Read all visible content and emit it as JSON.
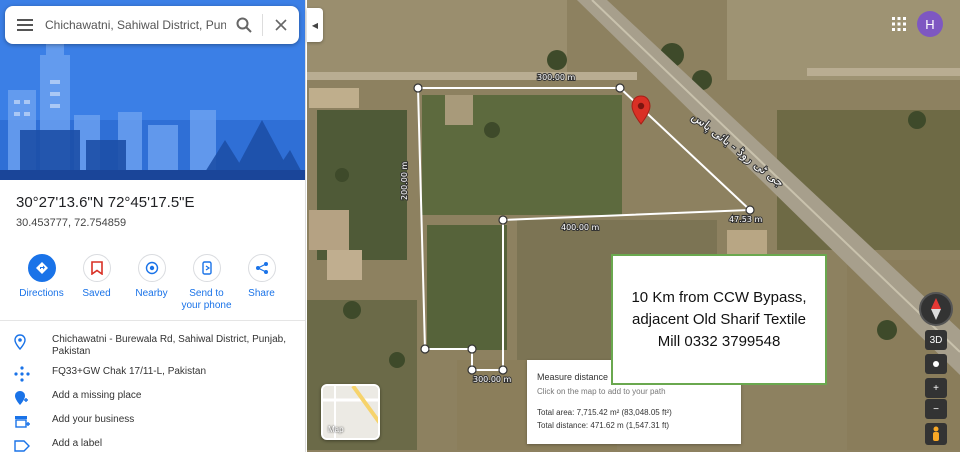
{
  "search": {
    "value": "Chichawatni, Sahiwal District, Punjab",
    "placeholder": "Search Google Maps"
  },
  "location": {
    "coords_dms": "30°27'13.6\"N 72°45'17.5\"E",
    "coords_decimal": "30.453777, 72.754859"
  },
  "actions": [
    {
      "label": "Directions",
      "icon": "directions-icon"
    },
    {
      "label": "Saved",
      "icon": "bookmark-icon"
    },
    {
      "label": "Nearby",
      "icon": "nearby-icon"
    },
    {
      "label": "Send to your phone",
      "icon": "send-to-phone-icon"
    },
    {
      "label": "Share",
      "icon": "share-icon"
    }
  ],
  "info": {
    "address": "Chichawatni - Burewala Rd, Sahiwal District, Punjab, Pakistan",
    "plus_code": "FQ33+GW Chak 17/11-L, Pakistan",
    "add_place": "Add a missing place",
    "add_business": "Add your business",
    "add_label": "Add a label"
  },
  "map": {
    "road_name": "جی ٹی روڈ - بائی پاس",
    "segments": [
      "300.00 m",
      "200.00 m",
      "400.00 m",
      "47.53 m",
      "300.00 m"
    ],
    "annotation_lines": [
      "10 Km from CCW Bypass,",
      "adjacent Old Sharif Textile",
      "Mill 0332 3799548"
    ],
    "measure": {
      "title": "Measure distance",
      "hint": "Click on the map to add to your path",
      "area": "Total area: 7,715.42 m² (83,048.05 ft²)",
      "distance": "Total distance: 471.62 m (1,547.31 ft)"
    },
    "layer_label": "Map",
    "view_3d": "3D",
    "zoom_in": "+",
    "zoom_out": "−",
    "avatar_initial": "H"
  },
  "colors": {
    "accent": "#1a73e8",
    "avatar": "#7e57c2",
    "pin": "#d93025",
    "annotation_border": "#6aa84f"
  }
}
